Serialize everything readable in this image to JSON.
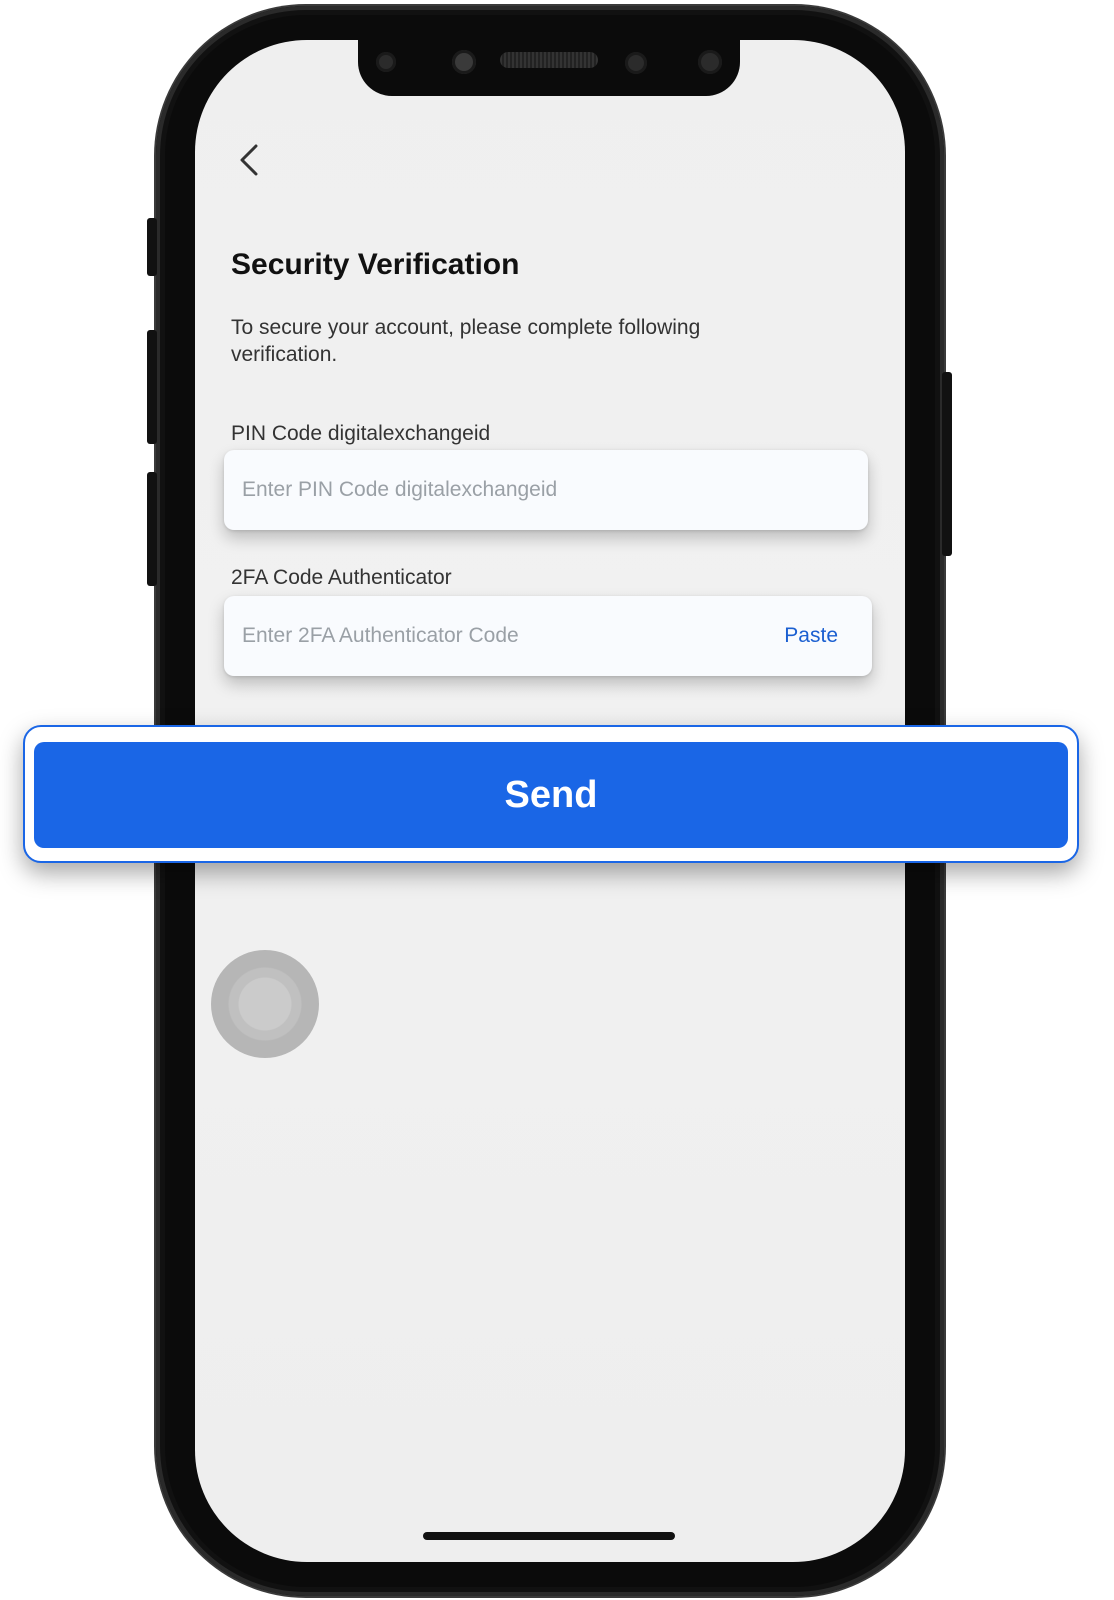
{
  "screen": {
    "back_icon": "chevron-left-icon",
    "title": "Security Verification",
    "subtitle": "To secure your account, please complete following verification."
  },
  "form": {
    "pin": {
      "label": "PIN Code digitalexchangeid",
      "placeholder": "Enter PIN Code digitalexchangeid",
      "value": ""
    },
    "twofa": {
      "label": "2FA Code Authenticator",
      "placeholder": "Enter 2FA Authenticator Code",
      "value": "",
      "paste_label": "Paste"
    }
  },
  "actions": {
    "send_label": "Send"
  },
  "colors": {
    "accent": "#1a66e6",
    "paste_link": "#1b5fd1",
    "screen_bg": "#efefef"
  }
}
